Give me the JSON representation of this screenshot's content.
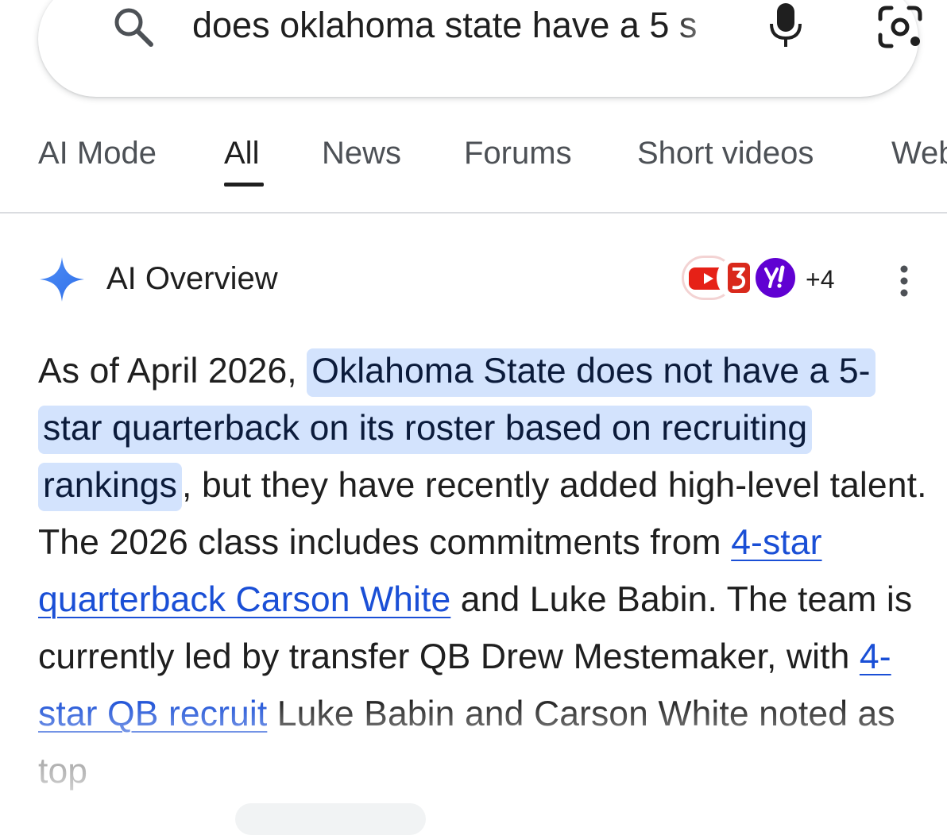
{
  "search": {
    "query": "does oklahoma state have a 5 s"
  },
  "tabs": [
    {
      "label": "AI Mode"
    },
    {
      "label": "All"
    },
    {
      "label": "News"
    },
    {
      "label": "Forums"
    },
    {
      "label": "Short videos"
    },
    {
      "label": "Web"
    }
  ],
  "ai_overview": {
    "title": "AI Overview",
    "sources_more": "+4",
    "source_icons": [
      "youtube-icon",
      "247sports-icon",
      "yahoo-icon"
    ],
    "p1": "As of April 2026, ",
    "p1_highlight": "Oklahoma State does not have a 5-star quarterback on its roster based on recruiting rankings",
    "p2": ", but they have recently added high-level talent. The 2026 class includes commitments from ",
    "link1": "4-star quarterback Carson White",
    "p3": " and Luke Babin. The team is currently led by transfer QB Drew Mestemaker, with ",
    "link2": "4-star QB recruit",
    "p4": " Luke Babin and Carson White noted as top"
  },
  "colors": {
    "accent": "#1a4fd6",
    "highlight": "#d3e3fd",
    "sparkle": "#3b7bf4"
  }
}
